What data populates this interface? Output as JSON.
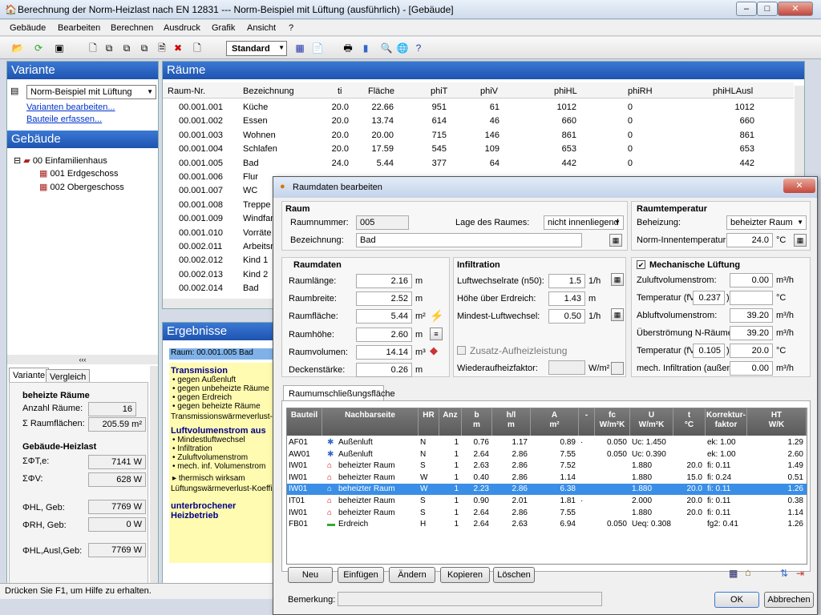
{
  "window": {
    "title": "Berechnung der Norm-Heizlast nach EN 12831 --- Norm-Beispiel mit Lüftung (ausführlich) - [Gebäude]"
  },
  "menu": [
    "Gebäude",
    "Bearbeiten",
    "Berechnen",
    "Ausdruck",
    "Grafik",
    "Ansicht",
    "?"
  ],
  "toolbar": {
    "view_combo": "Standard"
  },
  "variante": {
    "header": "Variante",
    "selected": "Norm-Beispiel mit Lüftung",
    "links": [
      "Varianten bearbeiten...",
      "Bauteile erfassen..."
    ]
  },
  "gebaeude": {
    "header": "Gebäude",
    "tree": [
      "00 Einfamilienhaus",
      "001 Erdgeschoss",
      "002 Obergeschoss"
    ]
  },
  "left_tabs": [
    "Variante",
    "Vergleich"
  ],
  "stats": {
    "s1_title": "beheizte Räume",
    "anzahl_label": "Anzahl Räume:",
    "anzahl": "16",
    "flaechen_label": "Σ Raumflächen:",
    "flaechen": "205.59 m²",
    "s2_title": "Gebäude-Heizlast",
    "rows": [
      {
        "label": "ΣΦT,e:",
        "value": "7141 W"
      },
      {
        "label": "ΣΦV:",
        "value": "628 W"
      },
      {
        "label": "ΦHL, Geb:",
        "value": "7769 W"
      },
      {
        "label": "ΦRH, Geb:",
        "value": "0 W"
      },
      {
        "label": "ΦHL,Ausl,Geb:",
        "value": "7769 W"
      }
    ]
  },
  "raeume": {
    "header": "Räume",
    "columns": [
      "Raum-Nr.",
      "Bezeichnung",
      "ti",
      "Fläche",
      "phiT",
      "phiV",
      "phiHL",
      "phiRH",
      "phiHLAusl"
    ],
    "rows": [
      [
        "00.001.001",
        "Küche",
        "20.0",
        "22.66",
        "951",
        "61",
        "1012",
        "0",
        "1012"
      ],
      [
        "00.001.002",
        "Essen",
        "20.0",
        "13.74",
        "614",
        "46",
        "660",
        "0",
        "660"
      ],
      [
        "00.001.003",
        "Wohnen",
        "20.0",
        "20.00",
        "715",
        "146",
        "861",
        "0",
        "861"
      ],
      [
        "00.001.004",
        "Schlafen",
        "20.0",
        "17.59",
        "545",
        "109",
        "653",
        "0",
        "653"
      ],
      [
        "00.001.005",
        "Bad",
        "24.0",
        "5.44",
        "377",
        "64",
        "442",
        "0",
        "442"
      ],
      [
        "00.001.006",
        "Flur",
        "",
        "",
        "",
        "",
        "",
        "",
        ""
      ],
      [
        "00.001.007",
        "WC",
        "",
        "",
        "",
        "",
        "",
        "",
        ""
      ],
      [
        "00.001.008",
        "Treppe",
        "",
        "",
        "",
        "",
        "",
        "",
        ""
      ],
      [
        "00.001.009",
        "Windfan",
        "",
        "",
        "",
        "",
        "",
        "",
        ""
      ],
      [
        "00.001.010",
        "Vorräte",
        "",
        "",
        "",
        "",
        "",
        "",
        ""
      ],
      [
        "00.002.011",
        "Arbeitsr",
        "",
        "",
        "",
        "",
        "",
        "",
        ""
      ],
      [
        "00.002.012",
        "Kind 1",
        "",
        "",
        "",
        "",
        "",
        "",
        ""
      ],
      [
        "00.002.013",
        "Kind 2",
        "",
        "",
        "",
        "",
        "",
        "",
        ""
      ],
      [
        "00.002.014",
        "Bad",
        "",
        "",
        "",
        "",
        "",
        "",
        ""
      ]
    ]
  },
  "ergebnisse": {
    "header": "Ergebnisse",
    "raum": "Raum: 00.001.005 Bad",
    "transmission": "Transmission",
    "t_items": [
      "gegen Außenluft",
      "gegen unbeheizte Räume",
      "gegen Erdreich",
      "gegen beheizte Räume"
    ],
    "t_koeff": "Transmissionswärmeverlust-K",
    "luft": "Luftvolumenstrom aus",
    "l_items": [
      "Mindestluftwechsel",
      "Infiltration",
      "Zuluftvolumenstrom",
      "mech. inf. Volumenstrom"
    ],
    "thermisch": "thermisch wirksam",
    "l_koeff": "Lüftungswärmeverlust-Koeffiz",
    "unterbrochen": "unterbrochener Heizbetrieb"
  },
  "status": "Drücken Sie F1, um Hilfe zu erhalten.",
  "dialog": {
    "title": "Raumdaten bearbeiten",
    "raum": {
      "title": "Raum",
      "nr_label": "Raumnummer:",
      "nr": "005",
      "lage_label": "Lage des Raumes:",
      "lage": "nicht innenliegend",
      "bez_label": "Bezeichnung:",
      "bez": "Bad"
    },
    "raumtemp": {
      "title": "Raumtemperatur",
      "heiz_label": "Beheizung:",
      "heiz": "beheizter Raum",
      "temp_label": "Norm-Innentemperatur:",
      "temp": "24.0",
      "unit": "°C"
    },
    "raumdaten": {
      "title": "Raumdaten",
      "rows": [
        {
          "label": "Raumlänge:",
          "value": "2.16",
          "unit": "m"
        },
        {
          "label": "Raumbreite:",
          "value": "2.52",
          "unit": "m"
        },
        {
          "label": "Raumfläche:",
          "value": "5.44",
          "unit": "m²"
        },
        {
          "label": "Raumhöhe:",
          "value": "2.60",
          "unit": "m"
        },
        {
          "label": "Raumvolumen:",
          "value": "14.14",
          "unit": "m³"
        },
        {
          "label": "Deckenstärke:",
          "value": "0.26",
          "unit": "m"
        }
      ]
    },
    "infiltration": {
      "title": "Infiltration",
      "rows": [
        {
          "label": "Luftwechselrate (n50):",
          "value": "1.5",
          "unit": "1/h"
        },
        {
          "label": "Höhe über Erdreich:",
          "value": "1.43",
          "unit": "m"
        },
        {
          "label": "Mindest-Luftwechsel:",
          "value": "0.50",
          "unit": "1/h"
        }
      ],
      "zusatz": "Zusatz-Aufheizleistung",
      "wieder_label": "Wiederaufheizfaktor:",
      "wieder_unit": "W/m²"
    },
    "mech": {
      "title": "Mechanische Lüftung",
      "rows": [
        {
          "label": "Zuluftvolumenstrom:",
          "value": "0.00",
          "unit": "m³/h"
        },
        {
          "label": "Temperatur (fV:",
          "f": "0.237",
          "value": "",
          "unit": "°C"
        },
        {
          "label": "Abluftvolumenstrom:",
          "value": "39.20",
          "unit": "m³/h"
        },
        {
          "label": "Überströmung N-Räume:",
          "value": "39.20",
          "unit": "m³/h"
        },
        {
          "label": "Temperatur (fV:",
          "f": "0.105",
          "value": "20.0",
          "unit": "°C"
        },
        {
          "label": "mech. Infiltration (außen):",
          "value": "0.00",
          "unit": "m³/h"
        }
      ]
    },
    "tab": "Raumumschließungsfläche",
    "grid_cols": [
      "Bauteil",
      "Nachbarseite",
      "HR",
      "Anz",
      "b\nm",
      "h/l\nm",
      "A\nm²",
      "-",
      "fc\nW/m²K",
      "U\nW/m²K",
      "t\n°C",
      "Korrektur-\nfaktor",
      "HT\nW/K"
    ],
    "grid": [
      [
        "AF01",
        "Außenluft",
        "N",
        "1",
        "0.76",
        "1.17",
        "0.89",
        "·",
        "0.050",
        "Uc: 1.450",
        "",
        "ek: 1.00",
        "1.29"
      ],
      [
        "AW01",
        "Außenluft",
        "N",
        "1",
        "2.64",
        "2.86",
        "7.55",
        "",
        "0.050",
        "Uc: 0.390",
        "",
        "ek: 1.00",
        "2.60"
      ],
      [
        "IW01",
        "beheizter Raum",
        "S",
        "1",
        "2.63",
        "2.86",
        "7.52",
        "",
        "",
        "1.880",
        "20.0",
        "fi: 0.11",
        "1.49"
      ],
      [
        "IW01",
        "beheizter Raum",
        "W",
        "1",
        "0.40",
        "2.86",
        "1.14",
        "",
        "",
        "1.880",
        "15.0",
        "fi: 0.24",
        "0.51"
      ],
      [
        "IW01",
        "beheizter Raum",
        "W",
        "1",
        "2.23",
        "2.86",
        "6.38",
        "",
        "",
        "1.880",
        "20.0",
        "fi: 0.11",
        "1.26"
      ],
      [
        "IT01",
        "beheizter Raum",
        "S",
        "1",
        "0.90",
        "2.01",
        "1.81",
        "·",
        "",
        "2.000",
        "20.0",
        "fi: 0.11",
        "0.38"
      ],
      [
        "IW01",
        "beheizter Raum",
        "S",
        "1",
        "2.64",
        "2.86",
        "7.55",
        "",
        "",
        "1.880",
        "20.0",
        "fi: 0.11",
        "1.14"
      ],
      [
        "FB01",
        "Erdreich",
        "H",
        "1",
        "2.64",
        "2.63",
        "6.94",
        "",
        "0.050",
        "Ueq: 0.308",
        "",
        "fg2: 0.41",
        "1.26"
      ]
    ],
    "buttons": [
      "Neu",
      "Einfügen",
      "Ändern",
      "Kopieren",
      "Löschen"
    ],
    "bemerkung_label": "Bemerkung:",
    "ok": "OK",
    "cancel": "Abbrechen"
  }
}
